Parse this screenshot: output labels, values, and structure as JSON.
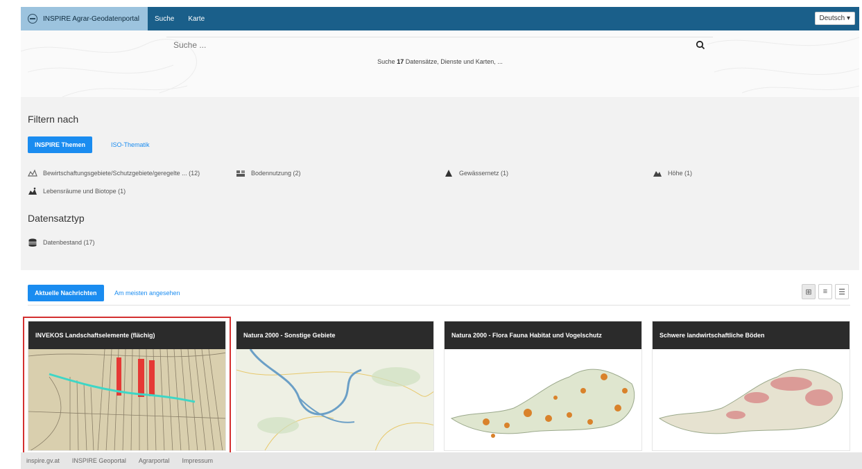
{
  "nav": {
    "brand": "INSPIRE Agrar-Geodatenportal",
    "links": [
      "Suche",
      "Karte"
    ],
    "language": "Deutsch ▾"
  },
  "search": {
    "placeholder": "Suche ...",
    "hint_prefix": "Suche",
    "count": "17",
    "hint_suffix": "Datensätze, Dienste und Karten, ..."
  },
  "filter": {
    "heading": "Filtern nach",
    "tabs": [
      "INSPIRE Themen",
      "ISO-Thematik"
    ],
    "topics": [
      {
        "label": "Bewirtschaftungsgebiete/Schutzgebiete/geregelte ...  (12)",
        "icon": "protected-areas-icon"
      },
      {
        "label": "Bodennutzung (2)",
        "icon": "land-use-icon"
      },
      {
        "label": "Gewässernetz (1)",
        "icon": "hydrography-icon"
      },
      {
        "label": "Höhe (1)",
        "icon": "elevation-icon"
      },
      {
        "label": "Lebensräume und Biotope (1)",
        "icon": "habitats-icon"
      }
    ],
    "type_heading": "Datensatztyp",
    "types": [
      {
        "label": "Datenbestand (17)",
        "icon": "database-icon"
      }
    ]
  },
  "news": {
    "tabs": [
      "Aktuelle Nachrichten",
      "Am meisten angesehen"
    ],
    "view_modes": [
      "⊞",
      "≡",
      "☰"
    ],
    "cards": [
      {
        "title": "INVEKOS Landschaftselemente (flächig)"
      },
      {
        "title": "Natura 2000 - Sonstige Gebiete"
      },
      {
        "title": "Natura 2000 - Flora Fauna Habitat und Vogelschutz"
      },
      {
        "title": "Schwere landwirtschaftliche Böden"
      }
    ]
  },
  "footer": {
    "links": [
      "inspire.gv.at",
      "INSPIRE Geoportal",
      "Agrarportal",
      "Impressum"
    ]
  },
  "colors": {
    "navbar": "#1a5f8a",
    "brand_bg": "#9cc3de",
    "accent": "#1a8cf0",
    "card_header": "#2b2b2b",
    "highlight": "#d32f2f"
  }
}
